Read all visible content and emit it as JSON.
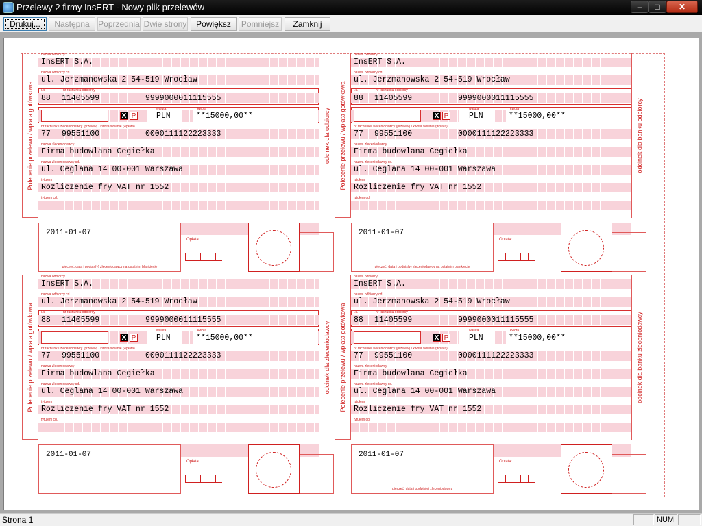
{
  "window": {
    "title": "Przelewy 2 firmy InsERT - Nowy plik przelewów",
    "min": "–",
    "max": "□",
    "close": "✕"
  },
  "toolbar": {
    "print": "Drukuj...",
    "next": "Następna",
    "prev": "Poprzednia",
    "two_pages": "Dwie strony",
    "zoom_in": "Powiększ",
    "zoom_out": "Pomniejsz",
    "close": "Zamknij"
  },
  "form_labels": {
    "recipient_name": "nazwa odbiorcy",
    "recipient_name_cd": "nazwa odbiorcy cd.",
    "account_ctrl": "l.k.",
    "recipient_account": "nr rachunku odbiorcy",
    "currency": "waluta",
    "amount": "kwota",
    "payer_account": "nr rachunku zleceniodawcy (przelew) / kwota słownie (wpłata)",
    "payer_name": "nazwa zleceniodawcy",
    "payer_name_cd": "nazwa zleceniodawcy cd.",
    "title": "tytułem",
    "title_cd": "tytułem cd.",
    "oplata": "Opłata:",
    "side_left": "Polecenie przelewu / wpłata gotówkowa"
  },
  "forms": [
    {
      "recipient_name": "InsERT S.A.",
      "recipient_address": "ul. Jerzmanowska 2 54-519 Wrocław",
      "account_ctrl": "88",
      "account_part1": "11405599",
      "account_part2": "9999000011115555",
      "x_mark": "X",
      "p_mark": "P",
      "currency": "PLN",
      "amount": "**15000,00**",
      "payer_ctrl": "77",
      "payer_part1": "99551100",
      "payer_part2": "0000111122223333",
      "payer_name": "Firma budowlana Cegiełka",
      "payer_address": "ul. Ceglana 14 00-001 Warszawa",
      "title": "Rozliczenie fry VAT nr 1552",
      "date": "2011-01-07",
      "signature": "pieczęć, data i podpis(y) zleceniodawcy na ostatnim blankiecie",
      "side_right": "odcinek dla odbiorcy"
    },
    {
      "recipient_name": "InsERT S.A.",
      "recipient_address": "ul. Jerzmanowska 2 54-519 Wrocław",
      "account_ctrl": "88",
      "account_part1": "11405599",
      "account_part2": "9999000011115555",
      "x_mark": "X",
      "p_mark": "P",
      "currency": "PLN",
      "amount": "**15000,00**",
      "payer_ctrl": "77",
      "payer_part1": "99551100",
      "payer_part2": "0000111122223333",
      "payer_name": "Firma budowlana Cegiełka",
      "payer_address": "ul. Ceglana 14 00-001 Warszawa",
      "title": "Rozliczenie fry VAT nr 1552",
      "date": "2011-01-07",
      "signature": "pieczęć, data i podpis(y) zleceniodawcy na ostatnim blankiecie",
      "side_right": "odcinek dla banku odbiorcy"
    },
    {
      "recipient_name": "InsERT S.A.",
      "recipient_address": "ul. Jerzmanowska 2 54-519 Wrocław",
      "account_ctrl": "88",
      "account_part1": "11405599",
      "account_part2": "9999000011115555",
      "x_mark": "X",
      "p_mark": "P",
      "currency": "PLN",
      "amount": "**15000,00**",
      "payer_ctrl": "77",
      "payer_part1": "99551100",
      "payer_part2": "0000111122223333",
      "payer_name": "Firma budowlana Cegiełka",
      "payer_address": "ul. Ceglana 14 00-001 Warszawa",
      "title": "Rozliczenie fry VAT nr 1552",
      "date": "2011-01-07",
      "signature": "",
      "side_right": "odcinek dla zleceniodawcy"
    },
    {
      "recipient_name": "InsERT S.A.",
      "recipient_address": "ul. Jerzmanowska 2 54-519 Wrocław",
      "account_ctrl": "88",
      "account_part1": "11405599",
      "account_part2": "9999000011115555",
      "x_mark": "X",
      "p_mark": "P",
      "currency": "PLN",
      "amount": "**15000,00**",
      "payer_ctrl": "77",
      "payer_part1": "99551100",
      "payer_part2": "0000111122223333",
      "payer_name": "Firma budowlana Cegiełka",
      "payer_address": "ul. Ceglana 14 00-001 Warszawa",
      "title": "Rozliczenie fry VAT nr 1552",
      "date": "2011-01-07",
      "signature": "pieczęć, data i podpis(y) zleceniodawcy",
      "side_right": "odcinek dla banku zleceniodawcy"
    }
  ],
  "status": {
    "page": "Strona 1",
    "num": "NUM"
  },
  "colors": {
    "form_red": "#d02020",
    "form_pink": "#f8d3da",
    "preview_bg": "#a9a9a9"
  }
}
